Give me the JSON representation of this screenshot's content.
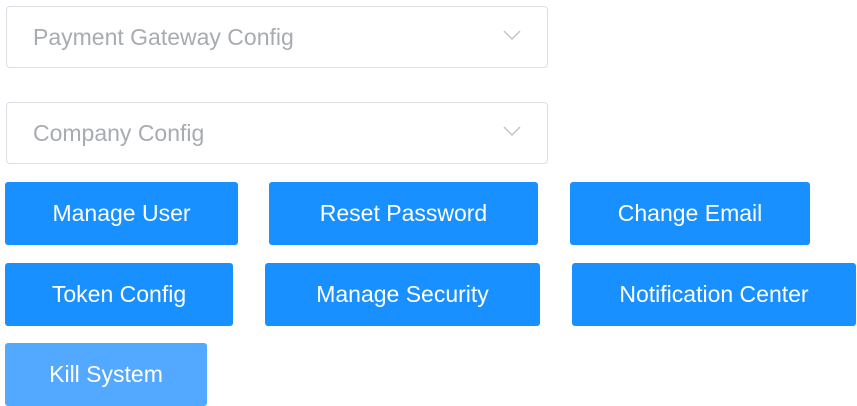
{
  "selects": [
    {
      "placeholder": "Payment Gateway Config",
      "chevron_icon": "chevron-down-icon"
    },
    {
      "placeholder": "Company Config",
      "chevron_icon": "chevron-down-icon"
    }
  ],
  "buttons": {
    "manage_user": "Manage User",
    "reset_password": "Reset Password",
    "change_email": "Change Email",
    "token_config": "Token Config",
    "manage_security": "Manage Security",
    "notification_center": "Notification Center",
    "kill_system": "Kill System"
  },
  "colors": {
    "primary": "#1890ff",
    "primary_disabled": "#53a8ff",
    "placeholder_text": "#a8abb2",
    "border": "#dcdfe6"
  }
}
